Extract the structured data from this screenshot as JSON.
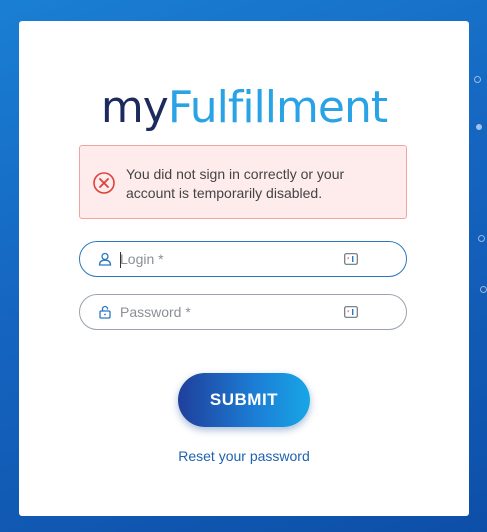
{
  "logo": {
    "part1": "my",
    "part2": "Fulfillment"
  },
  "alert": {
    "message": "You did not sign in correctly or your account is temporarily disabled."
  },
  "login": {
    "placeholder": "Login *",
    "value": ""
  },
  "password": {
    "placeholder": "Password *",
    "value": ""
  },
  "submit": {
    "label": "SUBMIT"
  },
  "reset": {
    "label": "Reset your password"
  },
  "colors": {
    "accent": "#29a3e6",
    "brand_dark": "#1e2a5e",
    "error": "#e0403a",
    "background": "#1565c0"
  }
}
